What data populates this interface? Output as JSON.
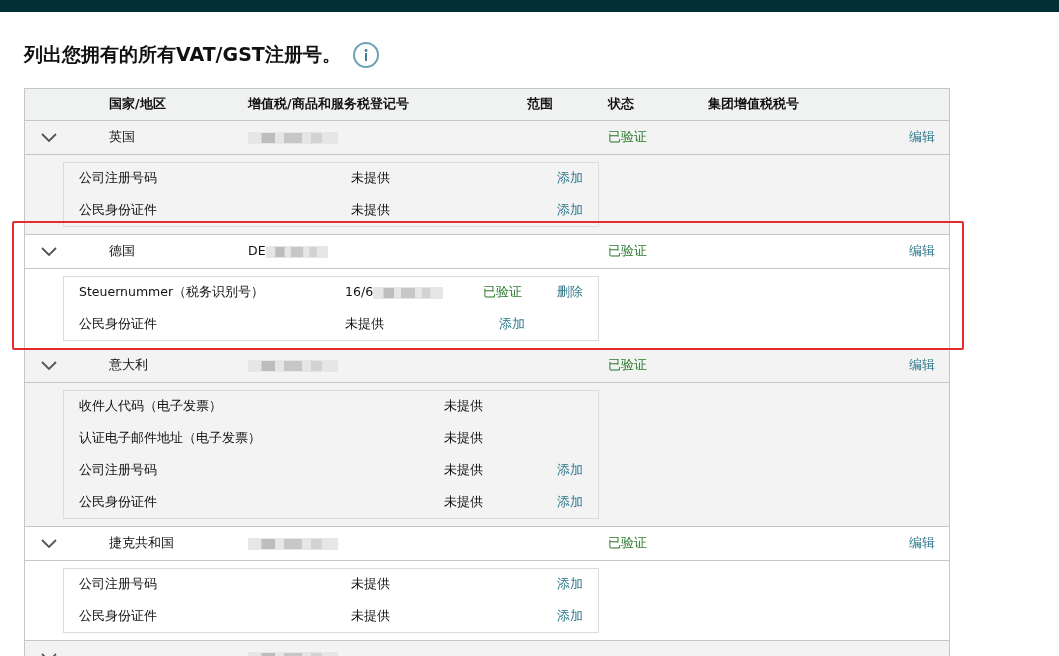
{
  "title": "列出您拥有的所有VAT/GST注册号。",
  "columns": [
    "国家/地区",
    "增值税/商品和服务税登记号",
    "范围",
    "状态",
    "集团增值税税号"
  ],
  "rows": [
    {
      "country": "英国",
      "number": "",
      "redacted": true,
      "status": "已验证",
      "action": "编辑",
      "expanded": true,
      "highlighted": false,
      "details": [
        {
          "label": "公司注册号码",
          "value": "未提供",
          "action": "添加"
        },
        {
          "label": "公民身份证件",
          "value": "未提供",
          "action": "添加"
        }
      ]
    },
    {
      "country": "德国",
      "number": "DE",
      "redacted": true,
      "status": "已验证",
      "action": "编辑",
      "expanded": true,
      "highlighted": true,
      "details": [
        {
          "label": "Steuernummer（税务识别号）",
          "value": "16/6",
          "redacted": true,
          "status": "已验证",
          "action": "删除"
        },
        {
          "label": "公民身份证件",
          "value": "未提供",
          "action": "添加"
        }
      ]
    },
    {
      "country": "意大利",
      "number": "",
      "redacted": true,
      "status": "已验证",
      "action": "编辑",
      "expanded": true,
      "highlighted": false,
      "details": [
        {
          "label": "收件人代码（电子发票）",
          "value": "未提供"
        },
        {
          "label": "认证电子邮件地址（电子发票）",
          "value": "未提供"
        },
        {
          "label": "公司注册号码",
          "value": "未提供",
          "action": "添加"
        },
        {
          "label": "公民身份证件",
          "value": "未提供",
          "action": "添加"
        }
      ]
    },
    {
      "country": "捷克共和国",
      "number": "",
      "redacted": true,
      "status": "已验证",
      "action": "编辑",
      "expanded": true,
      "highlighted": false,
      "details": [
        {
          "label": "公司注册号码",
          "value": "未提供",
          "action": "添加"
        },
        {
          "label": "公民身份证件",
          "value": "未提供",
          "action": "添加"
        }
      ]
    },
    {
      "number": "",
      "redacted": true,
      "expanded": true,
      "highlighted": false,
      "details": []
    }
  ]
}
